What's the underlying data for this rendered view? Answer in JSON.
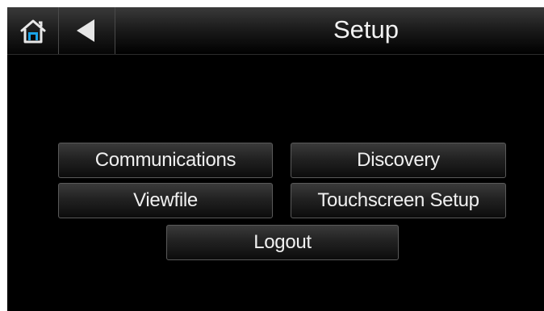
{
  "header": {
    "title": "Setup",
    "home_icon": "home-icon",
    "back_icon": "back-arrow-icon"
  },
  "buttons": {
    "communications": "Communications",
    "discovery": "Discovery",
    "viewfile": "Viewfile",
    "touchscreen_setup": "Touchscreen Setup",
    "logout": "Logout"
  },
  "colors": {
    "background": "#000000",
    "home_icon_accent": "#1aa3e8",
    "text": "#f0f0f0"
  }
}
